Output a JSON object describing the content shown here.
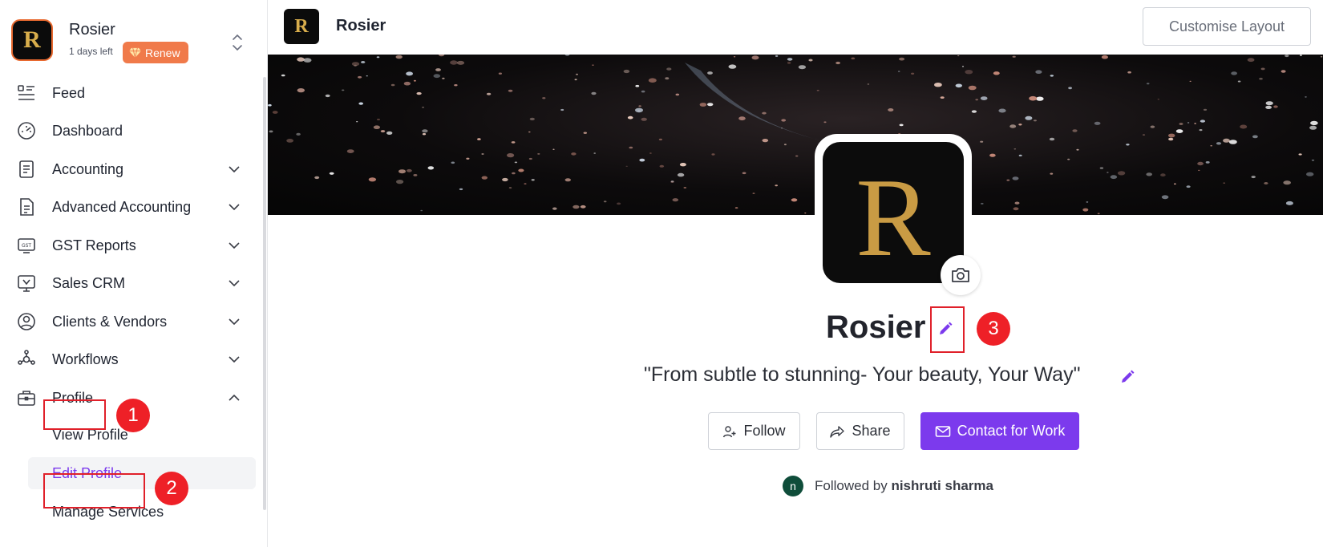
{
  "org": {
    "name": "Rosier",
    "logo_letter": "R",
    "days_left": "1 days left",
    "renew_label": "Renew"
  },
  "sidebar": {
    "items": [
      {
        "label": "Feed",
        "icon": "feed-icon"
      },
      {
        "label": "Dashboard",
        "icon": "dashboard-icon"
      },
      {
        "label": "Accounting",
        "icon": "accounting-icon",
        "expandable": true
      },
      {
        "label": "Advanced Accounting",
        "icon": "advanced-accounting-icon",
        "expandable": true
      },
      {
        "label": "GST Reports",
        "icon": "gst-icon",
        "expandable": true
      },
      {
        "label": "Sales CRM",
        "icon": "crm-icon",
        "expandable": true
      },
      {
        "label": "Clients & Vendors",
        "icon": "clients-icon",
        "expandable": true
      },
      {
        "label": "Workflows",
        "icon": "workflows-icon",
        "expandable": true
      },
      {
        "label": "Profile",
        "icon": "briefcase-icon",
        "expanded": true
      }
    ],
    "profile_subitems": [
      {
        "label": "View Profile"
      },
      {
        "label": "Edit Profile",
        "active": true
      },
      {
        "label": "Manage Services"
      }
    ]
  },
  "header": {
    "title": "Rosier",
    "customise_label": "Customise Layout"
  },
  "profile": {
    "name": "Rosier",
    "tagline": "\"From subtle to stunning- Your beauty, Your Way\"",
    "follow_label": "Follow",
    "share_label": "Share",
    "contact_label": "Contact for Work",
    "followed_by_prefix": "Followed by",
    "followed_by_name": "nishruti sharma",
    "follower_initial": "n"
  },
  "annotations": [
    "1",
    "2",
    "3"
  ],
  "colors": {
    "accent": "#7c3aed",
    "renew": "#f07a4a",
    "annotation": "#ee2027",
    "logo_gold": "#d8ad4c"
  }
}
